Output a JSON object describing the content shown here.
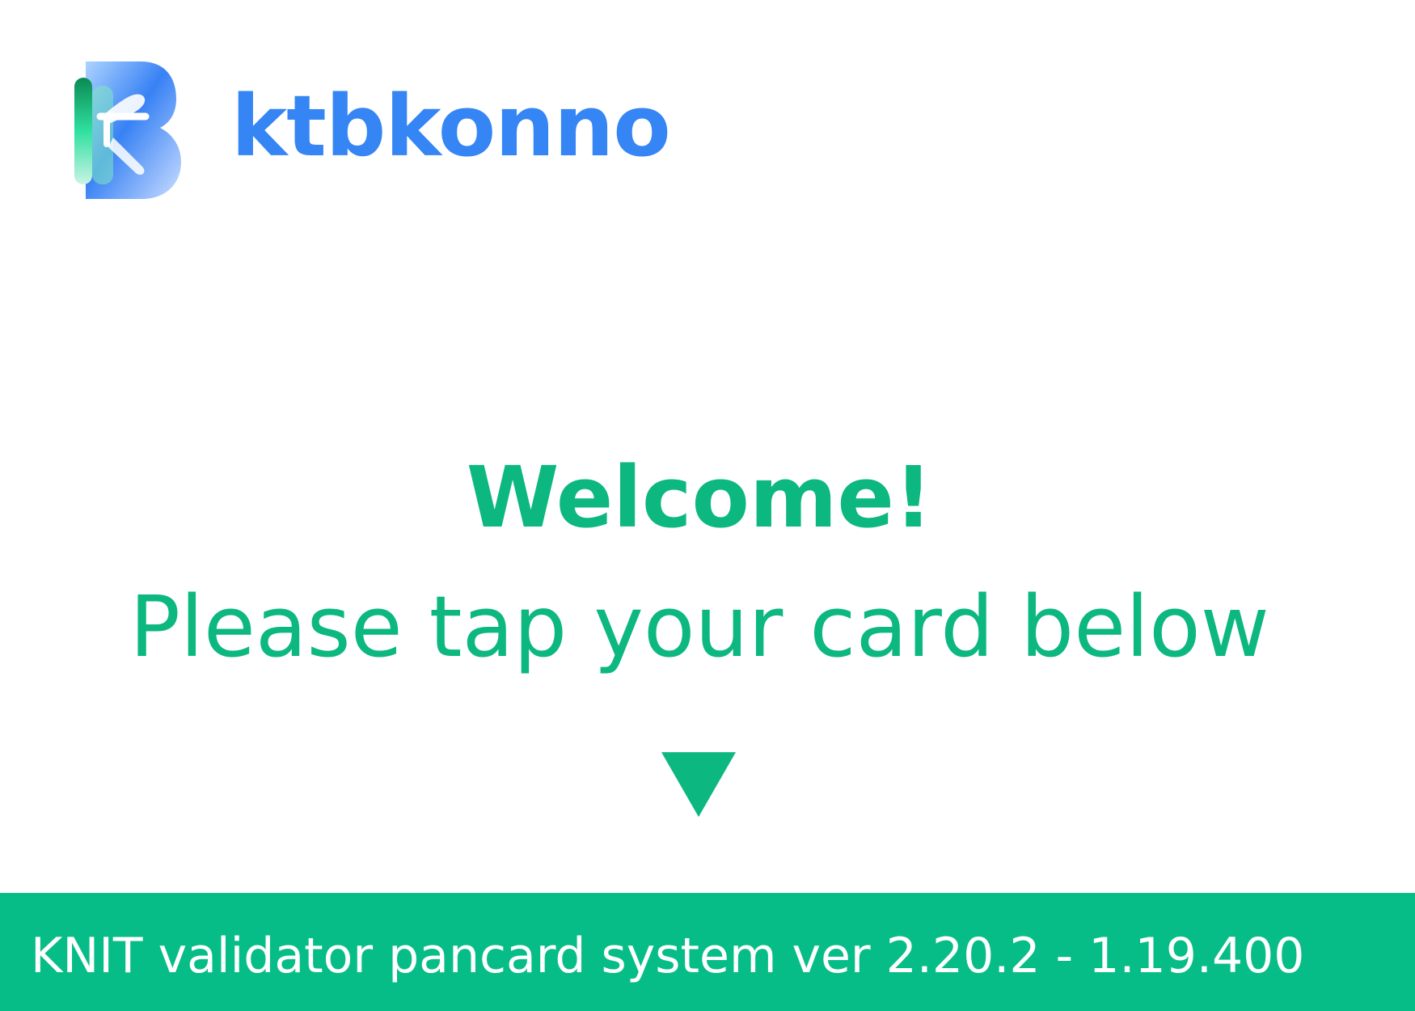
{
  "brand": {
    "name": "ktbkonno",
    "logo_icon": "ktb-logo-icon",
    "color": "#3585f5"
  },
  "main": {
    "title": "Welcome!",
    "instruction": "Please tap your card below",
    "arrow_icon": "down-triangle-icon",
    "accent_color": "#0db780"
  },
  "footer": {
    "version_text": "KNIT validator pancard system ver 2.20.2 - 1.19.400",
    "background_color": "#07bd87"
  }
}
